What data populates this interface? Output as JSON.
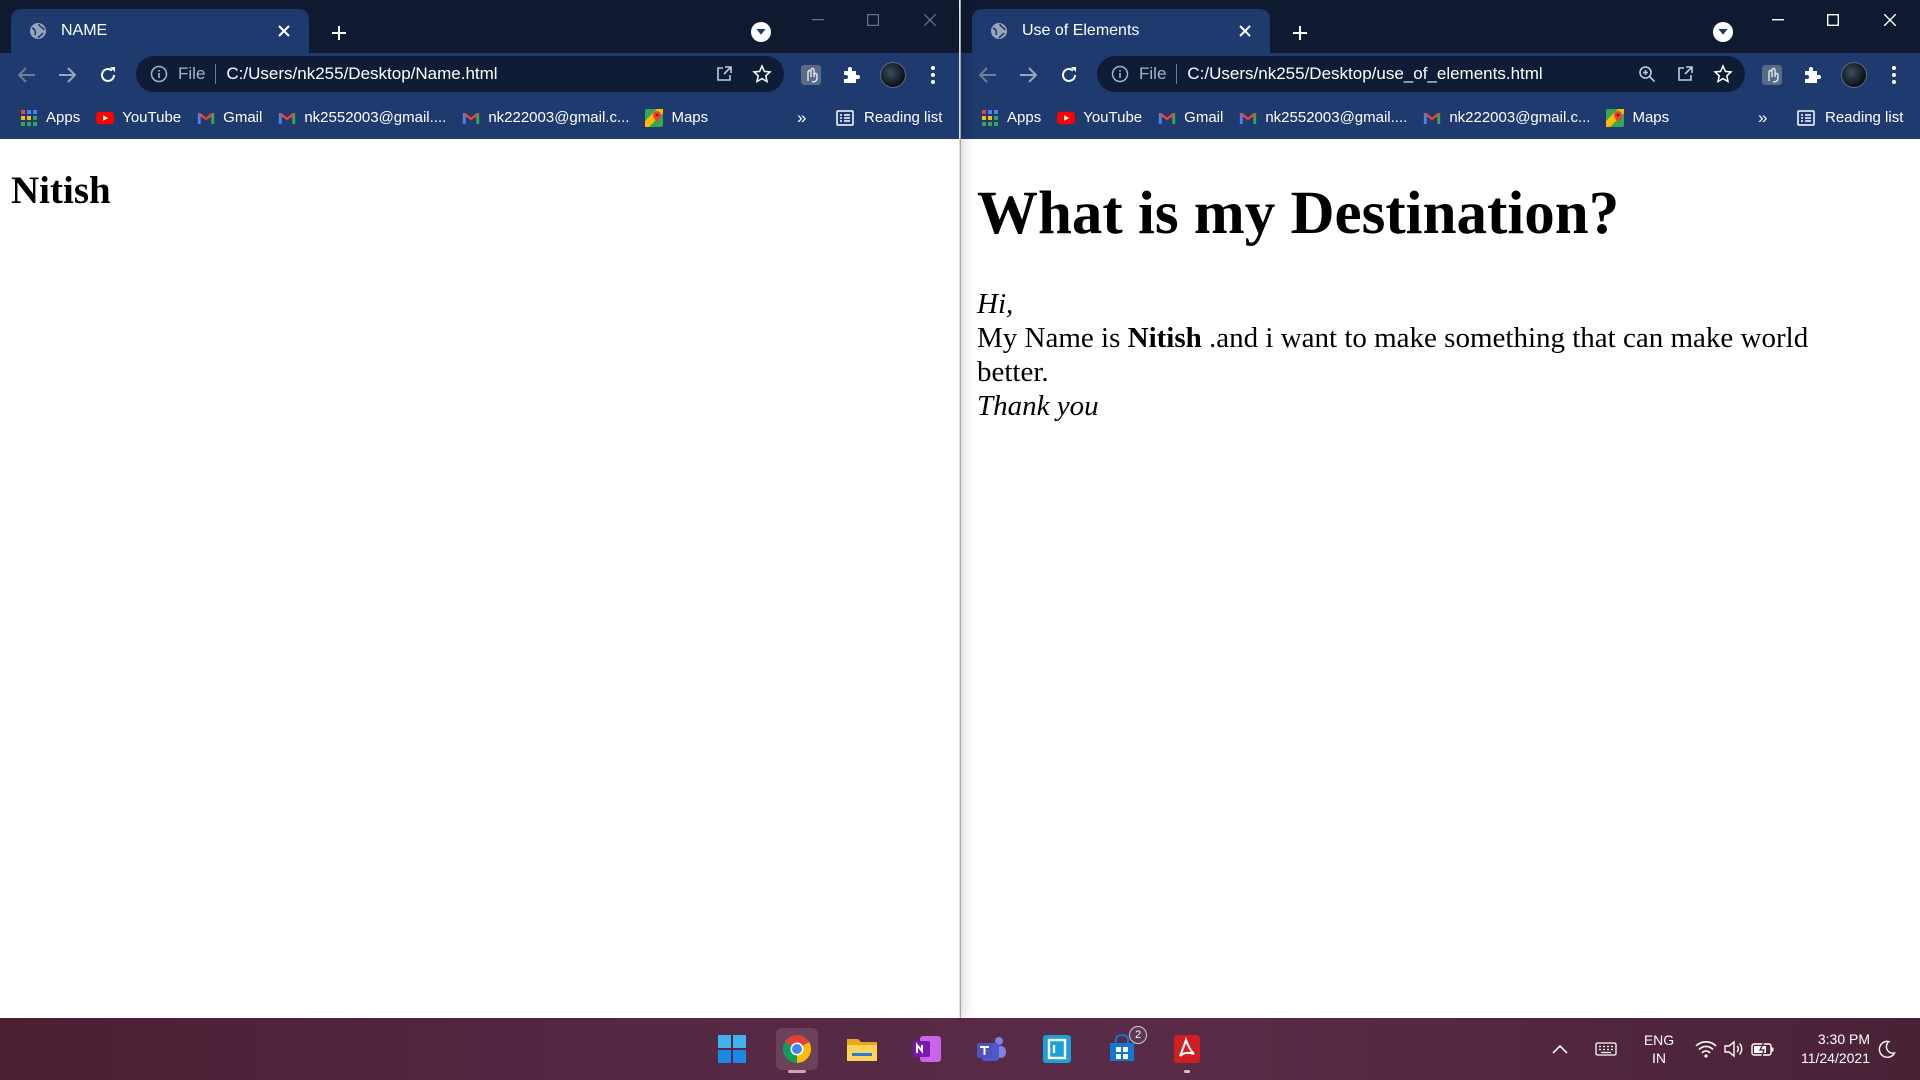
{
  "left_window": {
    "tab_title": "NAME",
    "file_label": "File",
    "url": "C:/Users/nk255/Desktop/Name.html",
    "page": {
      "heading": "Nitish"
    }
  },
  "right_window": {
    "tab_title": "Use of Elements",
    "file_label": "File",
    "url": "C:/Users/nk255/Desktop/use_of_elements.html",
    "page": {
      "heading": "What is my Destination?",
      "greeting": "Hi,",
      "line_prefix": "My Name is ",
      "name_bold": "Nitish",
      "line_suffix": " .and i want to make something that can make world better.",
      "closing": "Thank you"
    }
  },
  "bookmarks": {
    "items": [
      {
        "label": "Apps",
        "icon": "apps-grid-icon"
      },
      {
        "label": "YouTube",
        "icon": "youtube-icon"
      },
      {
        "label": "Gmail",
        "icon": "gmail-icon"
      },
      {
        "label": "nk2552003@gmail....",
        "icon": "gmail-icon"
      },
      {
        "label": "nk222003@gmail.c...",
        "icon": "gmail-icon"
      },
      {
        "label": "Maps",
        "icon": "maps-icon"
      }
    ],
    "overflow": "»",
    "reading_list": "Reading list"
  },
  "taskbar": {
    "apps": [
      "start",
      "chrome",
      "file-explorer",
      "onenote",
      "teams",
      "app-frame",
      "microsoft-store",
      "adobe-acrobat"
    ],
    "store_badge": "2",
    "language": {
      "line1": "ENG",
      "line2": "IN"
    },
    "clock": {
      "time": "3:30 PM",
      "date": "11/24/2021"
    }
  },
  "colors": {
    "tabstrip": "#0f1a30",
    "toolbar": "#1e3a6e",
    "omnibox": "#0e1c36",
    "taskbar": "#532742"
  }
}
